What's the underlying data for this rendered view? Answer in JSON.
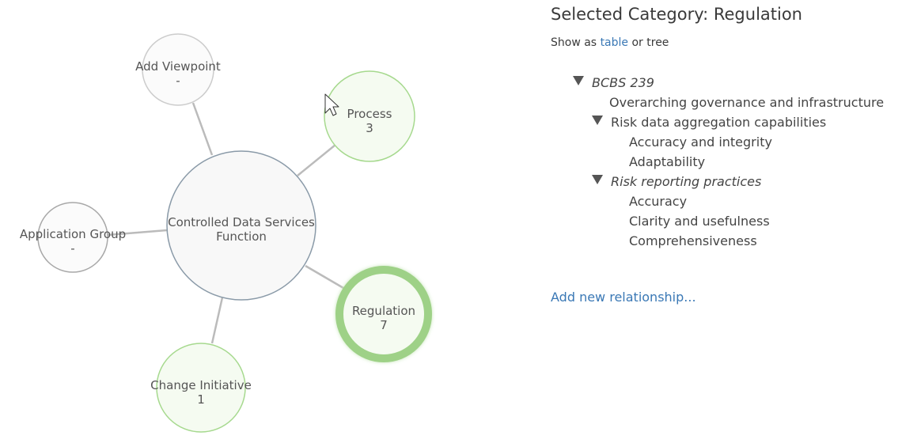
{
  "graph": {
    "center": {
      "label_line1": "Controlled Data Services",
      "label_line2": "Function"
    },
    "nodes": [
      {
        "id": "add-viewpoint",
        "label": "Add Viewpoint",
        "count": "-",
        "state": "empty"
      },
      {
        "id": "process",
        "label": "Process",
        "count": "3",
        "state": "populated"
      },
      {
        "id": "application-group",
        "label": "Application Group",
        "count": "-",
        "state": "empty"
      },
      {
        "id": "regulation",
        "label": "Regulation",
        "count": "7",
        "state": "selected"
      },
      {
        "id": "change-initiative",
        "label": "Change Initiative",
        "count": "1",
        "state": "populated"
      }
    ],
    "colors": {
      "center_fill": "#f8f8f8",
      "center_stroke": "#8a9aa8",
      "empty_fill": "#fbfbfb",
      "empty_stroke": "#cccccc",
      "populated_fill": "#f5fbf1",
      "populated_stroke": "#a6d98e",
      "selected_ring": "#9ed187",
      "edge": "#bbbbbb"
    }
  },
  "panel": {
    "title": "Selected Category: Regulation",
    "show_as_prefix": "Show as",
    "show_as_table": "table",
    "show_as_or": "or tree",
    "tree": [
      {
        "label": "BCBS 239",
        "level": 0,
        "expandable": true,
        "italic": true
      },
      {
        "label": "Overarching governance and infrastructure",
        "level": 1,
        "expandable": false,
        "italic": false
      },
      {
        "label": "Risk data aggregation capabilities",
        "level": 1,
        "expandable": true,
        "italic": false
      },
      {
        "label": "Accuracy and integrity",
        "level": 2,
        "expandable": false,
        "italic": false
      },
      {
        "label": "Adaptability",
        "level": 2,
        "expandable": false,
        "italic": false
      },
      {
        "label": "Risk reporting practices",
        "level": 1,
        "expandable": true,
        "italic": true
      },
      {
        "label": "Accuracy",
        "level": 2,
        "expandable": false,
        "italic": false
      },
      {
        "label": "Clarity and usefulness",
        "level": 2,
        "expandable": false,
        "italic": false
      },
      {
        "label": "Comprehensiveness",
        "level": 2,
        "expandable": false,
        "italic": false
      }
    ],
    "add_relationship": "Add new relationship..."
  },
  "cursor": {
    "icon": "mouse-pointer-icon"
  }
}
